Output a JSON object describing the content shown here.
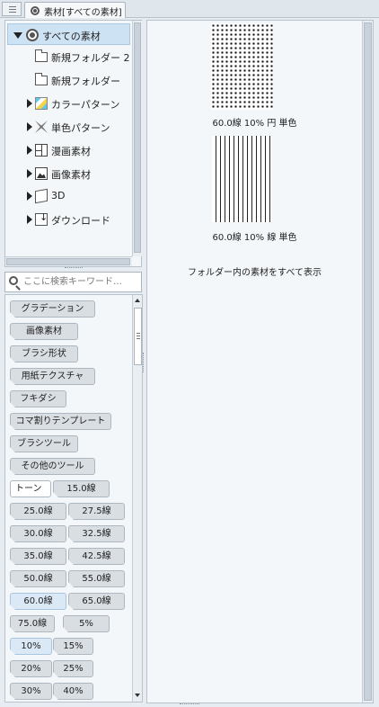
{
  "tab": {
    "title": "素材[すべての素材]"
  },
  "tree": {
    "items": [
      {
        "label": "すべての素材",
        "icon": "all-materials-icon"
      },
      {
        "label": "新規フォルダー 2",
        "icon": "folder-icon"
      },
      {
        "label": "新規フォルダー",
        "icon": "folder-icon"
      },
      {
        "label": "カラーパターン",
        "icon": "color-pattern-icon"
      },
      {
        "label": "単色パターン",
        "icon": "monochrome-pattern-icon"
      },
      {
        "label": "漫画素材",
        "icon": "manga-material-icon"
      },
      {
        "label": "画像素材",
        "icon": "image-material-icon"
      },
      {
        "label": "3D",
        "icon": "3d-cube-icon"
      },
      {
        "label": "ダウンロード",
        "icon": "download-icon"
      }
    ]
  },
  "search": {
    "placeholder": "ここに検索キーワード…"
  },
  "tags": [
    "グラデーション",
    "画像素材",
    "ブラシ形状",
    "用紙テクスチャ",
    "フキダシ",
    "コマ割りテンプレート",
    "ブラシツール",
    "その他のツール",
    "トーン",
    "15.0線",
    "25.0線",
    "27.5線",
    "30.0線",
    "32.5線",
    "35.0線",
    "42.5線",
    "50.0線",
    "55.0線",
    "60.0線",
    "65.0線",
    "75.0線",
    "5%",
    "10%",
    "15%",
    "20%",
    "25%",
    "30%",
    "40%"
  ],
  "preview": {
    "item1_caption": "60.0線 10% 円 単色",
    "item2_caption": "60.0線 10% 線 単色",
    "note": "フォルダー内の素材をすべて表示"
  }
}
